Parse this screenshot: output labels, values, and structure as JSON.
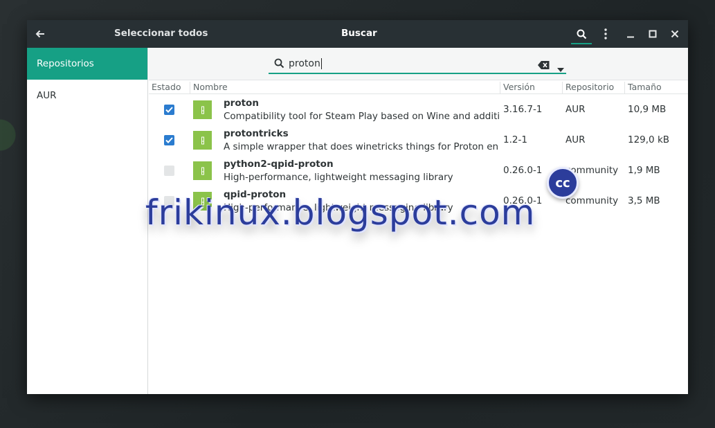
{
  "headerbar": {
    "left_title": "Seleccionar todos",
    "title": "Buscar"
  },
  "sidebar": {
    "items": [
      {
        "label": "Repositorios",
        "active": true
      },
      {
        "label": "AUR",
        "active": false
      }
    ]
  },
  "search": {
    "value": "proton"
  },
  "table": {
    "headers": {
      "estado": "Estado",
      "nombre": "Nombre",
      "version": "Versión",
      "repositorio": "Repositorio",
      "tamano": "Tamaño"
    },
    "rows": [
      {
        "checked": true,
        "name": "proton",
        "description": "Compatibility tool for Steam Play based on Wine and additional components",
        "version": "3.16.7-1",
        "repo": "AUR",
        "size": "10,9 MB"
      },
      {
        "checked": true,
        "name": "protontricks",
        "description": "A simple wrapper that does winetricks things for Proton enabled games",
        "version": "1.2-1",
        "repo": "AUR",
        "size": "129,0 kB"
      },
      {
        "checked": false,
        "name": "python2-qpid-proton",
        "description": "High-performance, lightweight messaging library",
        "version": "0.26.0-1",
        "repo": "community",
        "size": "1,9 MB"
      },
      {
        "checked": false,
        "name": "qpid-proton",
        "description": "High-performance, lightweight messaging library",
        "version": "0.26.0-1",
        "repo": "community",
        "size": "3,5 MB"
      }
    ]
  },
  "watermark": {
    "text": "frikinux.blogspot.com",
    "badge": "cc"
  },
  "colors": {
    "accent": "#16a085",
    "headerbar": "#283034",
    "checkbox": "#2b7ccf",
    "package_icon": "#8bc34a",
    "watermark": "#2c3d9b"
  },
  "icons": [
    "back-arrow-icon",
    "search-icon",
    "kebab-menu-icon",
    "minimize-icon",
    "maximize-icon",
    "close-icon",
    "clear-text-icon",
    "dropdown-arrow-icon",
    "checkmark-icon",
    "package-icon"
  ]
}
